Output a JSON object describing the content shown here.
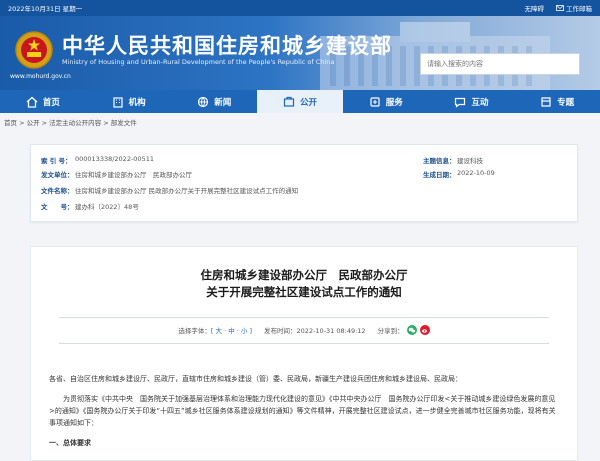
{
  "topbar": {
    "date": "2022年10月31日 星期一",
    "accessibility": "无障碍",
    "mobile": "工作邮箱"
  },
  "header": {
    "title_cn": "中华人民共和国住房和城乡建设部",
    "title_en": "Ministry of Housing and Urban-Rural Development of the People's Republic of China",
    "site": "www.mohurd.gov.cn",
    "search_placeholder": "请输入搜索的内容"
  },
  "nav": [
    {
      "label": "首页",
      "icon": "home-icon"
    },
    {
      "label": "机构",
      "icon": "building-icon"
    },
    {
      "label": "新闻",
      "icon": "globe-icon"
    },
    {
      "label": "公开",
      "icon": "open-icon"
    },
    {
      "label": "服务",
      "icon": "service-icon"
    },
    {
      "label": "互动",
      "icon": "chat-icon"
    },
    {
      "label": "专题",
      "icon": "topic-icon"
    }
  ],
  "breadcrumb": "首页 > 公开 > 法定主动公开内容 > 部发文件",
  "meta": {
    "index_label": "索 引 号：",
    "index_value": "000013338/2022-00511",
    "subject_label": "主题信息：",
    "subject_value": "建设科技",
    "issuer_label": "发文单位：",
    "issuer_value": "住房和城乡建设部办公厅　民政部办公厅",
    "date_label": "生成日期：",
    "date_value": "2022-10-09",
    "title_label": "文件名称：",
    "title_value": "住房和城乡建设部办公厅 民政部办公厅关于开展完整社区建设试点工作的通知",
    "doc_label": "文　　号：",
    "doc_value": "建办科〔2022〕48号"
  },
  "article": {
    "title_line1": "住房和城乡建设部办公厅　民政部办公厅",
    "title_line2": "关于开展完整社区建设试点工作的通知",
    "font_size_label": "选择字体：",
    "font_size_options": "[ 大 · 中 · 小 ]",
    "date_label": "发布时间：",
    "date_value": "2022-10-31 08:49:12",
    "share_label": "分享到：",
    "p1": "各省、自治区住房和城乡建设厅、民政厅，直辖市住房和城乡建设（管）委、民政局，新疆生产建设兵团住房和城乡建设局、民政局：",
    "p2": "为贯彻落实《中共中央　国务院关于加强基层治理体系和治理能力现代化建设的意见》《中共中央办公厅　国务院办公厅印发<关于推动城乡建设绿色发展的意见>的通知》《国务院办公厅关于印发“十四五”城乡社区服务体系建设规划的通知》等文件精神，开展完整社区建设试点，进一步健全完善城市社区服务功能，现将有关事项通知如下：",
    "sec1": "一、总体要求"
  }
}
